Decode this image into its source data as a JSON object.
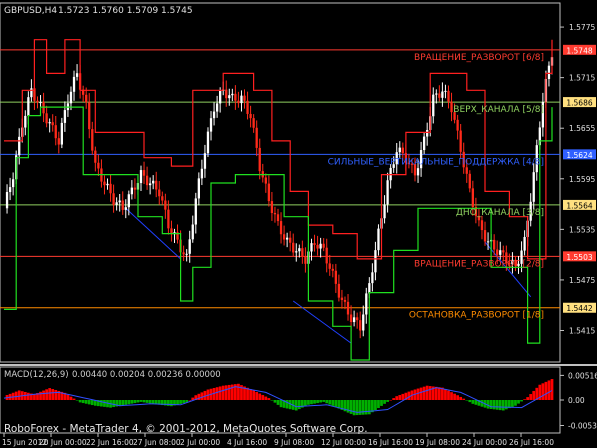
{
  "colors": {
    "background": "#000000",
    "frame": "#c0c0c0",
    "axis_text": "#e0e0e0",
    "candle_up": "#ffffff",
    "candle_down": "#ff2a1a",
    "band_upper": "#ff2020",
    "band_lower": "#20e020",
    "line_blue": "#2040ff",
    "murrey_red": "#ff3b30",
    "murrey_green": "#8fd060",
    "murrey_blue": "#3060ff",
    "murrey_orange": "#ff8c00",
    "tag_yellow_bg": "#ffe080",
    "macd_pos": "#ff0000",
    "macd_neg": "#00b000",
    "macd_signal": "#3050ff",
    "macd_label": "#d0d0d0"
  },
  "header": {
    "symbol_label": "GBPUSD,H4",
    "ohlc": "1.5723 1.5760 1.5709 1.5745"
  },
  "watermark": "RoboForex - MetaTrader 4, © 2001-2012, MetaQuotes Software Corp.",
  "chart_data": [
    {
      "type": "candlestick",
      "symbol": "GBPUSD",
      "timeframe": "H4",
      "ylim": [
        1.538,
        1.58
      ],
      "y_ticks": [
        "1.5775",
        "1.5715",
        "1.5655",
        "1.5595",
        "1.5535",
        "1.5475",
        "1.5415"
      ],
      "levels": [
        {
          "label": "ВРАЩЕНИЕ_РАЗВОРОТ [6/8]",
          "value": 1.5748,
          "tag": "1.5748",
          "color_key": "murrey_red"
        },
        {
          "label": "ВЕРХ_КАНАЛА [5/8]",
          "value": 1.5686,
          "tag": "1.5686",
          "color_key": "murrey_green"
        },
        {
          "label": "СИЛЬНЫЕ_ВЕРТИКАЛЬНЫЕ_ПОДДЕРЖКА [4/8]",
          "value": 1.5624,
          "tag": "1.5624",
          "color_key": "murrey_blue"
        },
        {
          "label": "ДНО_КАНАЛА [3/8]",
          "value": 1.5564,
          "tag": "1.5564",
          "color_key": "murrey_green"
        },
        {
          "label": "ВРАЩЕНИЕ_РАЗВОРОТ [2/8]",
          "value": 1.5503,
          "tag": "1.5503",
          "color_key": "murrey_red"
        },
        {
          "label": "ОСТАНОВКА_РАЗВОРОТ [1/8]",
          "value": 1.5442,
          "tag": "1.5442",
          "color_key": "murrey_orange"
        }
      ],
      "x_ticks": [
        "15 Jun 2012",
        "20 Jun 00:00",
        "22 Jun 16:00",
        "27 Jun 08:00",
        "2 Jul 00:00",
        "4 Jul 16:00",
        "9 Jul 08:00",
        "12 Jul 00:00",
        "16 Jul 16:00",
        "19 Jul 08:00",
        "24 Jul 00:00",
        "26 Jul 16:00"
      ],
      "close_path": [
        [
          0,
          1.556
        ],
        [
          3,
          1.56
        ],
        [
          6,
          1.566
        ],
        [
          9,
          1.57
        ],
        [
          12,
          1.568
        ],
        [
          15,
          1.566
        ],
        [
          18,
          1.564
        ],
        [
          21,
          1.569
        ],
        [
          24,
          1.572
        ],
        [
          27,
          1.568
        ],
        [
          30,
          1.561
        ],
        [
          33,
          1.559
        ],
        [
          36,
          1.557
        ],
        [
          39,
          1.556
        ],
        [
          42,
          1.558
        ],
        [
          45,
          1.56
        ],
        [
          48,
          1.559
        ],
        [
          51,
          1.558
        ],
        [
          54,
          1.554
        ],
        [
          57,
          1.552
        ],
        [
          60,
          1.55
        ],
        [
          63,
          1.557
        ],
        [
          66,
          1.563
        ],
        [
          69,
          1.568
        ],
        [
          72,
          1.57
        ],
        [
          75,
          1.569
        ],
        [
          78,
          1.569
        ],
        [
          81,
          1.567
        ],
        [
          84,
          1.561
        ],
        [
          87,
          1.557
        ],
        [
          90,
          1.554
        ],
        [
          93,
          1.552
        ],
        [
          96,
          1.551
        ],
        [
          99,
          1.55
        ],
        [
          102,
          1.552
        ],
        [
          105,
          1.551
        ],
        [
          108,
          1.548
        ],
        [
          111,
          1.545
        ],
        [
          114,
          1.543
        ],
        [
          117,
          1.542
        ],
        [
          120,
          1.547
        ],
        [
          123,
          1.553
        ],
        [
          126,
          1.559
        ],
        [
          129,
          1.563
        ],
        [
          132,
          1.562
        ],
        [
          135,
          1.56
        ],
        [
          138,
          1.564
        ],
        [
          141,
          1.569
        ],
        [
          144,
          1.57
        ],
        [
          147,
          1.568
        ],
        [
          150,
          1.563
        ],
        [
          153,
          1.558
        ],
        [
          156,
          1.554
        ],
        [
          159,
          1.552
        ],
        [
          162,
          1.551
        ],
        [
          165,
          1.55
        ],
        [
          168,
          1.549
        ],
        [
          171,
          1.552
        ],
        [
          174,
          1.56
        ],
        [
          177,
          1.569
        ],
        [
          180,
          1.5745
        ]
      ],
      "upper_band": [
        [
          0,
          1.564
        ],
        [
          6,
          1.57
        ],
        [
          10,
          1.576
        ],
        [
          14,
          1.572
        ],
        [
          20,
          1.576
        ],
        [
          25,
          1.57
        ],
        [
          30,
          1.565
        ],
        [
          40,
          1.565
        ],
        [
          46,
          1.562
        ],
        [
          55,
          1.561
        ],
        [
          62,
          1.57
        ],
        [
          66,
          1.57
        ],
        [
          72,
          1.572
        ],
        [
          76,
          1.572
        ],
        [
          82,
          1.57
        ],
        [
          88,
          1.564
        ],
        [
          94,
          1.558
        ],
        [
          100,
          1.554
        ],
        [
          108,
          1.553
        ],
        [
          116,
          1.55
        ],
        [
          124,
          1.56
        ],
        [
          132,
          1.565
        ],
        [
          140,
          1.572
        ],
        [
          146,
          1.572
        ],
        [
          152,
          1.57
        ],
        [
          158,
          1.558
        ],
        [
          166,
          1.555
        ],
        [
          172,
          1.55
        ],
        [
          178,
          1.572
        ],
        [
          180,
          1.576
        ]
      ],
      "lower_band": [
        [
          0,
          1.544
        ],
        [
          4,
          1.562
        ],
        [
          8,
          1.567
        ],
        [
          12,
          1.568
        ],
        [
          20,
          1.568
        ],
        [
          26,
          1.56
        ],
        [
          34,
          1.56
        ],
        [
          44,
          1.555
        ],
        [
          52,
          1.553
        ],
        [
          58,
          1.545
        ],
        [
          62,
          1.549
        ],
        [
          68,
          1.559
        ],
        [
          76,
          1.56
        ],
        [
          84,
          1.56
        ],
        [
          92,
          1.555
        ],
        [
          100,
          1.545
        ],
        [
          108,
          1.542
        ],
        [
          114,
          1.538
        ],
        [
          120,
          1.546
        ],
        [
          128,
          1.551
        ],
        [
          136,
          1.556
        ],
        [
          144,
          1.556
        ],
        [
          152,
          1.556
        ],
        [
          160,
          1.549
        ],
        [
          168,
          1.549
        ],
        [
          172,
          1.54
        ],
        [
          176,
          1.564
        ],
        [
          180,
          1.568
        ]
      ],
      "blue_trendlines": [
        [
          [
            40,
            1.556
          ],
          [
            58,
            1.55
          ]
        ],
        [
          [
            95,
            1.545
          ],
          [
            114,
            1.54
          ]
        ],
        [
          [
            158,
            1.552
          ],
          [
            173,
            1.5455
          ]
        ]
      ]
    },
    {
      "type": "histogram",
      "indicator": "MACD",
      "params": "MACD(12,26,9)",
      "values_text": "0.00440 0.00204 0.00236 0.00000",
      "ylim": [
        -0.0065,
        0.0065
      ],
      "y_ticks": [
        "0.00516",
        "0.00",
        "-0.00535"
      ],
      "histogram": [
        [
          0,
          0.0008
        ],
        [
          5,
          0.002
        ],
        [
          10,
          0.0012
        ],
        [
          15,
          0.0025
        ],
        [
          20,
          0.0015
        ],
        [
          25,
          -0.0005
        ],
        [
          30,
          -0.0012
        ],
        [
          35,
          -0.0016
        ],
        [
          40,
          -0.001
        ],
        [
          45,
          -0.0004
        ],
        [
          50,
          -0.0009
        ],
        [
          55,
          -0.0013
        ],
        [
          60,
          -0.0005
        ],
        [
          63,
          0.001
        ],
        [
          67,
          0.0022
        ],
        [
          72,
          0.003
        ],
        [
          77,
          0.0034
        ],
        [
          82,
          0.002
        ],
        [
          87,
          0.0004
        ],
        [
          91,
          -0.0015
        ],
        [
          96,
          -0.0022
        ],
        [
          100,
          -0.001
        ],
        [
          105,
          -0.0004
        ],
        [
          110,
          -0.0018
        ],
        [
          115,
          -0.0032
        ],
        [
          120,
          -0.003
        ],
        [
          125,
          -0.0008
        ],
        [
          129,
          0.0008
        ],
        [
          134,
          0.002
        ],
        [
          139,
          0.003
        ],
        [
          144,
          0.0026
        ],
        [
          149,
          0.001
        ],
        [
          154,
          -0.0008
        ],
        [
          159,
          -0.0018
        ],
        [
          164,
          -0.0022
        ],
        [
          168,
          -0.0012
        ],
        [
          172,
          0.0006
        ],
        [
          176,
          0.0032
        ],
        [
          180,
          0.0044
        ]
      ],
      "signal": [
        [
          0,
          0.0004
        ],
        [
          10,
          0.0012
        ],
        [
          18,
          0.0016
        ],
        [
          28,
          0.0002
        ],
        [
          38,
          -0.0012
        ],
        [
          48,
          -0.0008
        ],
        [
          58,
          -0.001
        ],
        [
          66,
          0.0008
        ],
        [
          76,
          0.0028
        ],
        [
          86,
          0.0016
        ],
        [
          96,
          -0.0014
        ],
        [
          106,
          -0.001
        ],
        [
          116,
          -0.0026
        ],
        [
          126,
          -0.002
        ],
        [
          134,
          0.001
        ],
        [
          142,
          0.0026
        ],
        [
          150,
          0.0016
        ],
        [
          160,
          -0.0014
        ],
        [
          170,
          -0.0016
        ],
        [
          180,
          0.002
        ]
      ]
    }
  ]
}
